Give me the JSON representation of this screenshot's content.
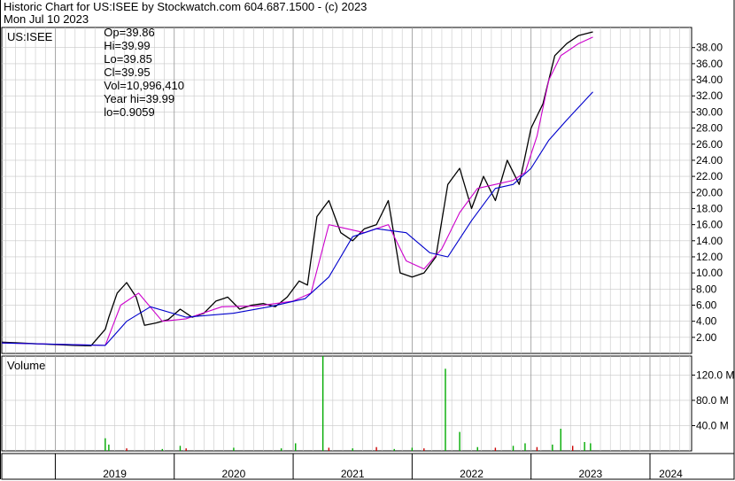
{
  "header": {
    "title": "Historic Chart for US:ISEE by Stockwatch.com 604.687.1500 - (c) 2023",
    "date": "Mon Jul 10 2023",
    "open": "Op=39.86",
    "high": "Hi=39.99",
    "low": "Lo=39.85",
    "close": "Cl=39.95",
    "volume": "Vol=10,996,410",
    "year_high": "Year hi=39.99",
    "year_low": "lo=0.9059"
  },
  "ticker_label": "US:ISEE",
  "volume_label": "Volume",
  "colors": {
    "price": "#000000",
    "ma_short": "#cc00cc",
    "ma_long": "#0000cc",
    "vol_up": "#00aa00",
    "vol_down": "#cc0000",
    "grid": "#c8c8c8"
  },
  "chart_data": {
    "type": "line",
    "series": [
      {
        "name": "Price",
        "x": [
          2018.55,
          2018.7,
          2018.85,
          2019.0,
          2019.15,
          2019.3,
          2019.42,
          2019.45,
          2019.52,
          2019.6,
          2019.68,
          2019.75,
          2019.85,
          2019.95,
          2020.05,
          2020.15,
          2020.25,
          2020.35,
          2020.45,
          2020.55,
          2020.65,
          2020.75,
          2020.85,
          2020.95,
          2021.05,
          2021.12,
          2021.2,
          2021.25,
          2021.3,
          2021.4,
          2021.5,
          2021.6,
          2021.7,
          2021.8,
          2021.9,
          2022.0,
          2022.1,
          2022.2,
          2022.3,
          2022.4,
          2022.5,
          2022.6,
          2022.7,
          2022.8,
          2022.9,
          2023.0,
          2023.1,
          2023.2,
          2023.3,
          2023.4,
          2023.52
        ],
        "values": [
          1.4,
          1.3,
          1.2,
          1.1,
          1.0,
          0.95,
          3.0,
          4.5,
          7.5,
          8.8,
          7.0,
          3.5,
          3.8,
          4.2,
          5.5,
          4.5,
          5.0,
          6.5,
          7.0,
          5.5,
          6.0,
          6.2,
          5.8,
          7.0,
          9.0,
          8.5,
          17.0,
          18.0,
          19.0,
          15.0,
          14.0,
          15.5,
          16.0,
          19.0,
          10.0,
          9.5,
          10.0,
          12.0,
          21.0,
          23.0,
          18.0,
          22.0,
          19.0,
          24.0,
          21.0,
          28.0,
          31.0,
          37.0,
          38.5,
          39.5,
          39.95
        ]
      },
      {
        "name": "MA short",
        "x": [
          2018.55,
          2019.42,
          2019.55,
          2019.7,
          2019.9,
          2020.1,
          2020.4,
          2020.7,
          2021.0,
          2021.15,
          2021.3,
          2021.45,
          2021.6,
          2021.8,
          2021.95,
          2022.1,
          2022.25,
          2022.4,
          2022.55,
          2022.7,
          2022.85,
          2022.95,
          2023.05,
          2023.15,
          2023.25,
          2023.4,
          2023.52
        ],
        "values": [
          1.3,
          1.0,
          6.0,
          7.5,
          4.0,
          4.3,
          5.8,
          5.9,
          6.5,
          7.5,
          16.0,
          15.5,
          15.0,
          16.0,
          11.5,
          10.5,
          13.0,
          17.5,
          20.5,
          21.0,
          21.5,
          22.5,
          27.0,
          34.0,
          37.0,
          38.5,
          39.3
        ]
      },
      {
        "name": "MA long",
        "x": [
          2018.55,
          2019.42,
          2019.6,
          2019.8,
          2020.1,
          2020.5,
          2020.8,
          2021.1,
          2021.3,
          2021.5,
          2021.7,
          2021.95,
          2022.15,
          2022.3,
          2022.5,
          2022.7,
          2022.85,
          2023.0,
          2023.15,
          2023.3,
          2023.52
        ],
        "values": [
          1.3,
          1.0,
          4.0,
          5.8,
          4.5,
          5.0,
          5.8,
          6.8,
          9.5,
          14.5,
          15.5,
          15.0,
          12.5,
          12.0,
          16.5,
          20.5,
          21.0,
          23.0,
          26.5,
          29.0,
          32.5
        ]
      }
    ],
    "volume": {
      "name": "Volume",
      "x": [
        2019.42,
        2019.45,
        2019.6,
        2019.9,
        2020.05,
        2020.1,
        2020.5,
        2020.9,
        2021.02,
        2021.25,
        2021.3,
        2021.5,
        2021.7,
        2021.85,
        2022.0,
        2022.1,
        2022.28,
        2022.4,
        2022.55,
        2022.7,
        2022.85,
        2022.95,
        2023.05,
        2023.18,
        2023.25,
        2023.35,
        2023.45,
        2023.5
      ],
      "values": [
        20,
        10,
        4,
        3,
        8,
        4,
        5,
        4,
        12,
        150,
        5,
        4,
        6,
        3,
        5,
        4,
        130,
        30,
        6,
        5,
        8,
        12,
        6,
        10,
        35,
        8,
        14,
        12
      ],
      "up": [
        true,
        true,
        false,
        true,
        true,
        false,
        true,
        true,
        true,
        true,
        false,
        true,
        false,
        true,
        true,
        false,
        true,
        true,
        true,
        false,
        true,
        true,
        false,
        true,
        true,
        false,
        true,
        true
      ]
    },
    "price_axis": {
      "ticks": [
        "2.00",
        "4.00",
        "6.00",
        "8.00",
        "10.00",
        "12.00",
        "14.00",
        "16.00",
        "18.00",
        "20.00",
        "22.00",
        "24.00",
        "26.00",
        "28.00",
        "30.00",
        "32.00",
        "34.00",
        "36.00",
        "38.00"
      ],
      "ylim": [
        0,
        40.5
      ]
    },
    "volume_axis": {
      "ticks": [
        "40.0 M",
        "80.0 M",
        "120.0 M"
      ],
      "ylim": [
        0,
        150
      ]
    },
    "x_axis": {
      "ticks": [
        "2019",
        "2020",
        "2021",
        "2022",
        "2023",
        "2024"
      ],
      "xlim": [
        2018.55,
        2024.35
      ]
    },
    "grid": true
  }
}
